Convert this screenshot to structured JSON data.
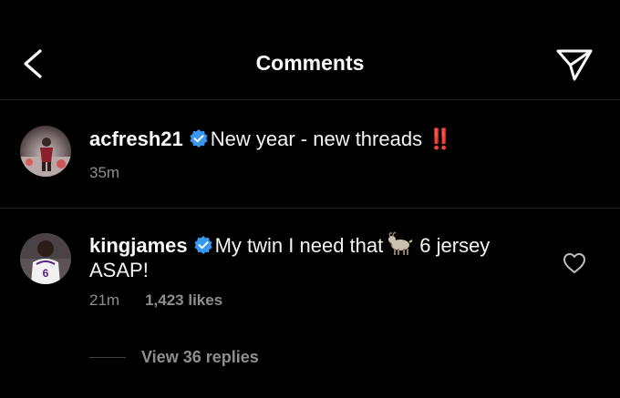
{
  "header": {
    "title": "Comments",
    "back_icon": "chevron-left-icon",
    "share_icon": "paper-plane-icon"
  },
  "caption": {
    "username": "acfresh21",
    "verified": true,
    "text": "New year - new threads",
    "emoji": "‼️",
    "time": "35m"
  },
  "comments": [
    {
      "username": "kingjames",
      "verified": true,
      "text_before": "My twin I need that",
      "emoji": "goat",
      "text_after": "6 jersey",
      "text_line2": "ASAP!",
      "time": "21m",
      "likes": "1,423 likes",
      "heart_icon": "heart-outline-icon",
      "view_replies": "View 36 replies"
    }
  ],
  "colors": {
    "background": "#000000",
    "text": "#f5f5f5",
    "secondary": "#8e8e8e",
    "verified": "#3897f0",
    "divider": "#1f1f1f"
  }
}
